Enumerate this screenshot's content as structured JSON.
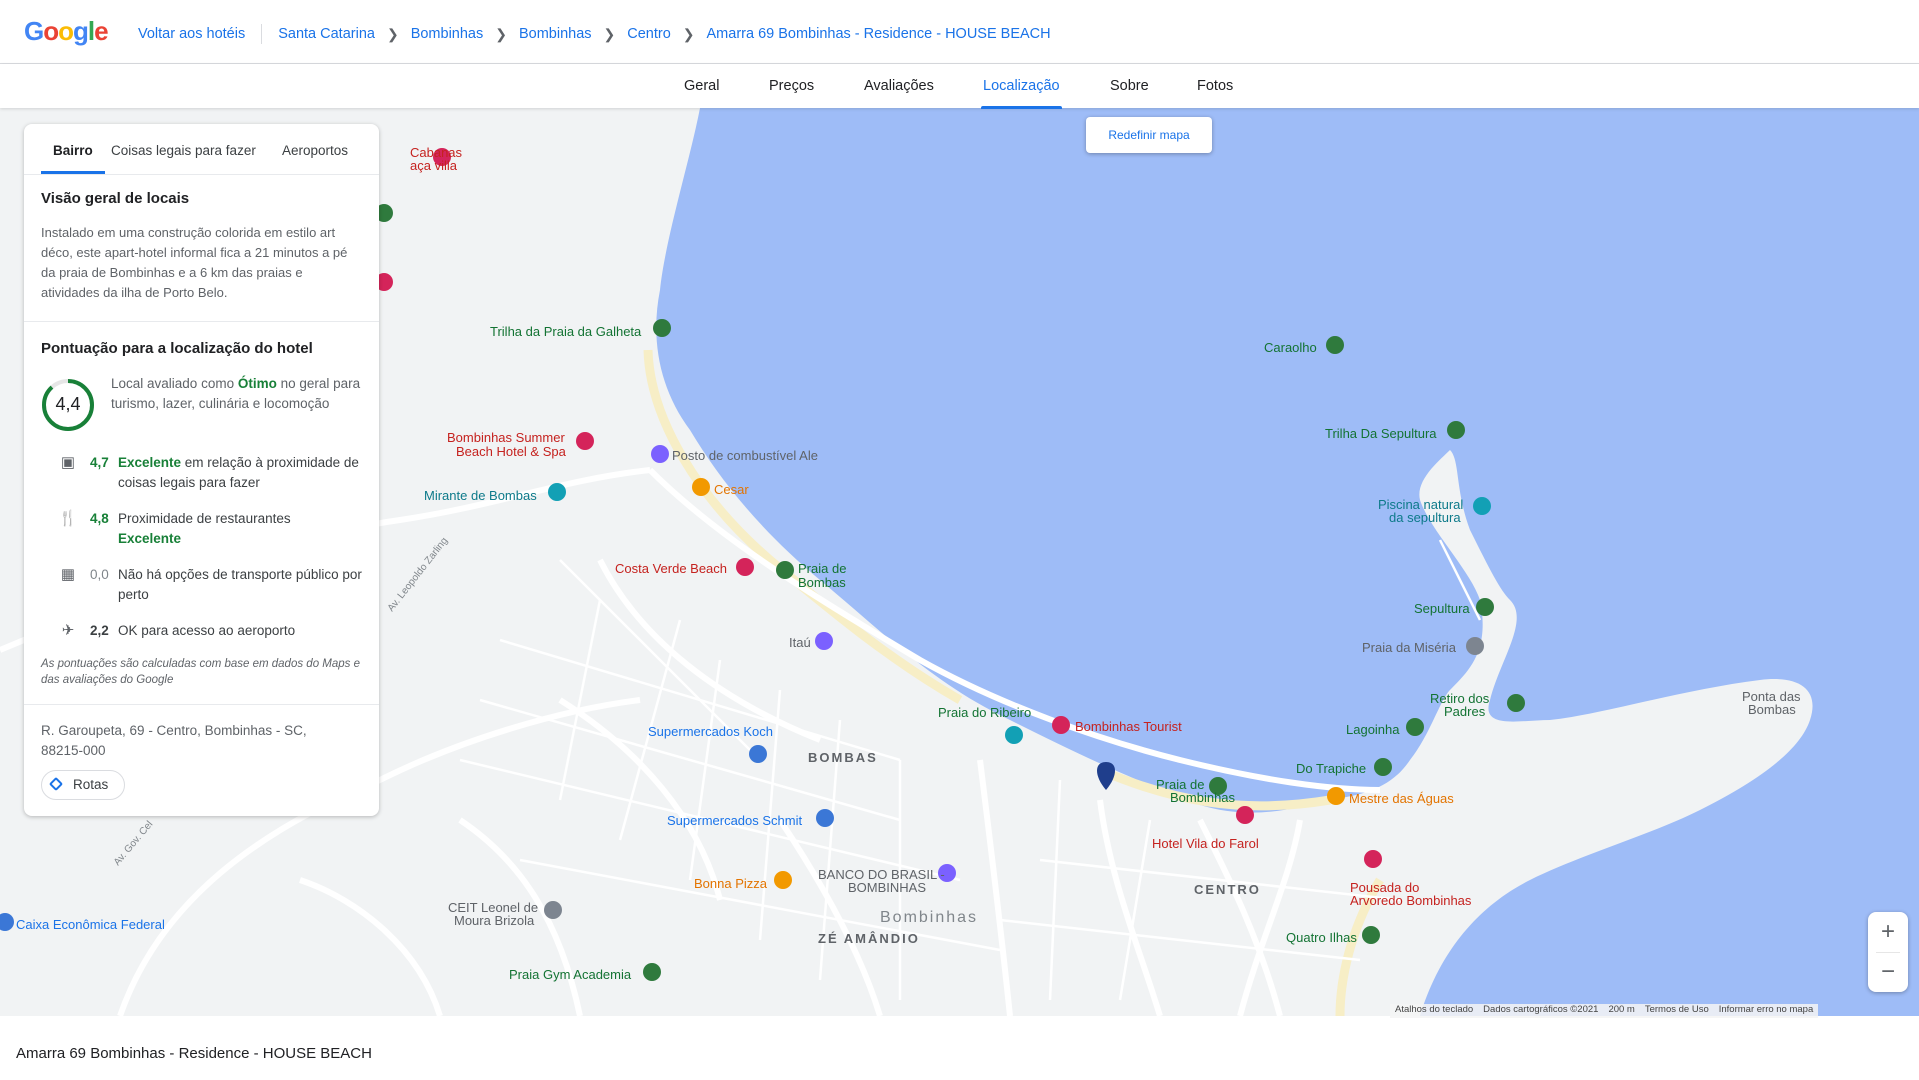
{
  "header": {
    "logo": "Google",
    "back_link": "Voltar aos hotéis",
    "breadcrumbs": [
      "Santa Catarina",
      "Bombinhas",
      "Bombinhas",
      "Centro",
      "Amarra 69 Bombinhas - Residence - HOUSE BEACH"
    ]
  },
  "tabs": [
    "Geral",
    "Preços",
    "Avaliações",
    "Localização",
    "Sobre",
    "Fotos"
  ],
  "active_tab": "Localização",
  "map": {
    "reset_button": "Redefinir mapa",
    "zoom_in": "+",
    "zoom_out": "−",
    "places": [
      "Cabanas",
      "aça villa",
      "Trilha da Praia da Galheta",
      "Caraolho",
      "Trilha Da Sepultura",
      "Piscina natural",
      "da sepultura",
      "Bombinhas Summer",
      "Beach Hotel & Spa",
      "Posto de combustível Ale",
      "Mirante de Bombas",
      "Cesar",
      "Costa Verde Beach",
      "Praia de",
      "Bombas",
      "Sepultura",
      "Praia da Miséria",
      "Itaú",
      "Ponta das",
      "Bombas",
      "Retiro dos",
      "Padres",
      "Lagoinha",
      "Praia do Ribeiro",
      "Bombinhas Tourist",
      "Supermercados Koch",
      "BOMBAS",
      "Do Trapiche",
      "Praia de",
      "Bombinhas",
      "Mestre das Águas",
      "Hotel Vila do Farol",
      "Supermercados Schmit",
      "Pousada do",
      "Arvoredo Bombinhas",
      "CENTRO",
      "BANCO DO BRASIL -",
      "BOMBINHAS",
      "Bonna Pizza",
      "Bombinhas",
      "ZÉ AMÂNDIO",
      "CEIT Leonel de",
      "Moura Brizola",
      "Quatro Ilhas",
      "Caixa Econômica Federal",
      "Praia Gym Academia",
      "Av. Leopoldo Zarling",
      "Av. Gov. Cel"
    ],
    "attribution": [
      "Atalhos do teclado",
      "Dados cartográficos ©2021",
      "200 m",
      "Termos de Uso",
      "Informar erro no mapa"
    ]
  },
  "panel": {
    "tabs": [
      "Bairro",
      "Coisas legais para fazer",
      "Aeroportos"
    ],
    "overview_title": "Visão geral de locais",
    "overview_text": "Instalado em uma construção colorida em estilo art déco, este apart-hotel informal fica a 21 minutos a pé da praia de Bombinhas e a 6 km das praias e atividades da ilha de Porto Belo.",
    "score_title": "Pontuação para a localização do hotel",
    "overall_score": "4,4",
    "overall_text_pre": "Local avaliado como ",
    "overall_text_rating": "Ótimo",
    "overall_text_post": " no geral para turismo, lazer, culinária e locomoção",
    "scores": [
      {
        "icon": "camera-icon",
        "score": "4,7",
        "rating": "Excelente",
        "text": " em relação à proximidade de coisas legais para fazer"
      },
      {
        "icon": "restaurant-icon",
        "score": "4,8",
        "text": "Proximidade de restaurantes",
        "rating": "Excelente"
      },
      {
        "icon": "bus-icon",
        "score": "0,0",
        "text": "Não há opções de transporte público por perto"
      },
      {
        "icon": "airplane-icon",
        "score": "2,2",
        "text": "OK para acesso ao aeroporto"
      }
    ],
    "note": "As pontuações são calculadas com base em dados do Maps e das avaliações do Google",
    "address": "R. Garoupeta, 69 - Centro, Bombinhas - SC, 88215-000",
    "directions_button": "Rotas"
  },
  "footer_title": "Amarra 69 Bombinhas - Residence - HOUSE BEACH",
  "colors": {
    "accent": "#1a73e8",
    "water": "#9ebcf7",
    "land": "#f1f3f4",
    "good": "#188038"
  }
}
